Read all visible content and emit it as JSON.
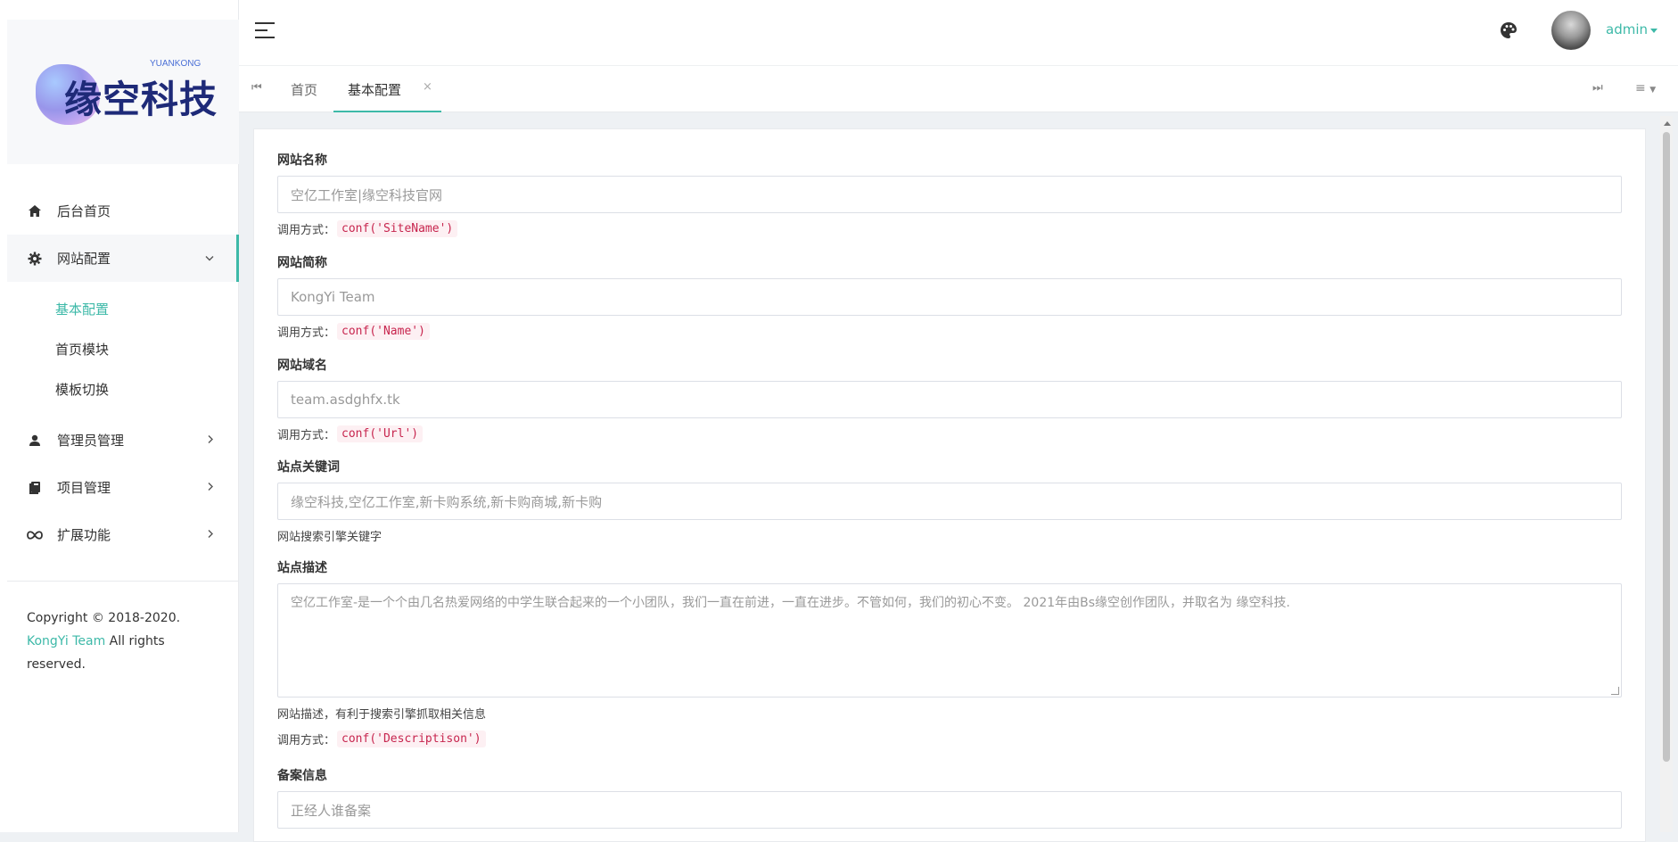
{
  "brand": {
    "logo_text": "缘空科技",
    "logo_sub": "YUANKONG"
  },
  "sidebar": {
    "items": [
      {
        "label": "后台首页",
        "icon": "home-icon"
      },
      {
        "label": "网站配置",
        "icon": "gear-icon",
        "open": true,
        "children": [
          "基本配置",
          "首页模块",
          "模板切换"
        ],
        "active_child": "基本配置"
      },
      {
        "label": "管理员管理",
        "icon": "user-icon"
      },
      {
        "label": "项目管理",
        "icon": "book-icon"
      },
      {
        "label": "扩展功能",
        "icon": "infinity-icon"
      }
    ],
    "copyright_prefix": "Copyright © 2018-2020. ",
    "copyright_team": "KongYi Team",
    "copyright_suffix": " All rights reserved."
  },
  "header": {
    "username": "admin"
  },
  "tabs": {
    "home": "首页",
    "active": "基本配置",
    "close": "×",
    "first": "⏮",
    "last": "⏭",
    "menu": "≡"
  },
  "form": {
    "help_prefix": "调用方式：",
    "fields": [
      {
        "label": "网站名称",
        "placeholder": "空亿工作室|缘空科技官网",
        "code": "conf('SiteName')"
      },
      {
        "label": "网站简称",
        "placeholder": "KongYi Team",
        "code": "conf('Name')"
      },
      {
        "label": "网站域名",
        "placeholder": "team.asdghfx.tk",
        "code": "conf('Url')"
      },
      {
        "label": "站点关键词",
        "placeholder": "缘空科技,空亿工作室,新卡购系统,新卡购商城,新卡购",
        "hint": "网站搜索引擎关键字"
      },
      {
        "label": "站点描述",
        "placeholder": "空亿工作室-是一个个由几名热爱网络的中学生联合起来的一个小团队，我们一直在前进，一直在进步。不管如何，我们的初心不变。 2021年由Bs缘空创作团队，并取名为 缘空科技.",
        "hint": "网站描述，有利于搜索引擎抓取相关信息",
        "code": "conf('Descriptison')"
      },
      {
        "label": "备案信息",
        "placeholder": "正经人谁备案"
      }
    ]
  },
  "colors": {
    "accent": "#3db9a8",
    "code_text": "#c7254e",
    "code_bg": "#fdf0f3"
  }
}
